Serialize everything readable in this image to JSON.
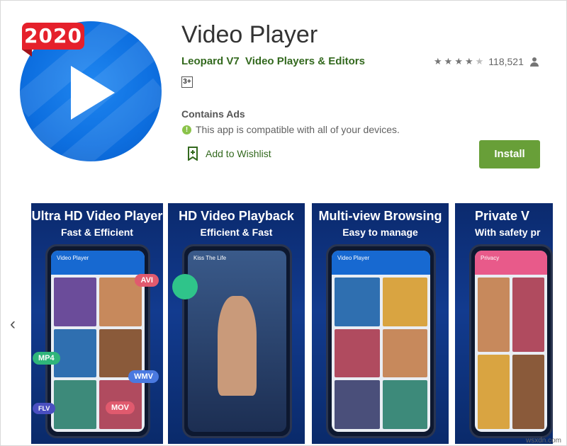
{
  "app": {
    "icon_badge": "2020",
    "title": "Video Player",
    "developer": "Leopard V7",
    "category": "Video Players & Editors",
    "rating_stars": 4.5,
    "rating_count": "118,521",
    "content_rating": "3+",
    "contains_ads": "Contains Ads",
    "compatibility": "This app is compatible with all of your devices.",
    "wishlist_label": "Add to Wishlist",
    "install_label": "Install"
  },
  "colors": {
    "brand_green": "#689f38",
    "link_green": "#33691e",
    "icon_blue": "#0d6fe0",
    "badge_red": "#e5202b"
  },
  "carousel": {
    "left_arrow": "‹",
    "right_arrow": "›",
    "screenshots": [
      {
        "headline": "Ultra HD Video Player",
        "subline": "Fast & Efficient",
        "app_bar": "Video Player",
        "tags": [
          "AVI",
          "MP4",
          "WMV",
          "MOV",
          "FLV"
        ]
      },
      {
        "headline": "HD Video Playback",
        "subline": "Efficient & Fast",
        "app_bar": "Kiss The Life"
      },
      {
        "headline": "Multi-view Browsing",
        "subline": "Easy to manage",
        "app_bar": "Video Player"
      },
      {
        "headline": "Private V",
        "subline": "With safety pr",
        "app_bar": "Privacy"
      }
    ]
  },
  "watermark": "wsxdn.com"
}
